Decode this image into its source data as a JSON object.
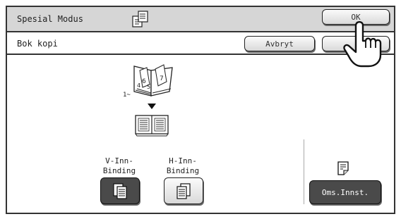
{
  "header": {
    "title": "Spesial Modus",
    "ok_label": "OK",
    "mode_icon": "copy-mode-icon"
  },
  "subheader": {
    "title": "Bok kopi",
    "cancel_label": "Avbryt"
  },
  "main": {
    "book_icon": "open-book-icon",
    "book_range_label": "1~",
    "arrow_icon": "down-arrow-icon",
    "spread_icon": "book-spread-icon",
    "binding_options": [
      {
        "label": "V-Inn-\nBinding",
        "selected": true,
        "icon": "left-binding-icon"
      },
      {
        "label": "H-Inn-\nBinding",
        "selected": false,
        "icon": "right-binding-icon"
      }
    ],
    "layout_icon": "page-layout-icon",
    "settings_label": "Oms.Innst."
  },
  "colors": {
    "selected_button": "#4a4a4a",
    "titlebar": "#d6d6d6"
  }
}
